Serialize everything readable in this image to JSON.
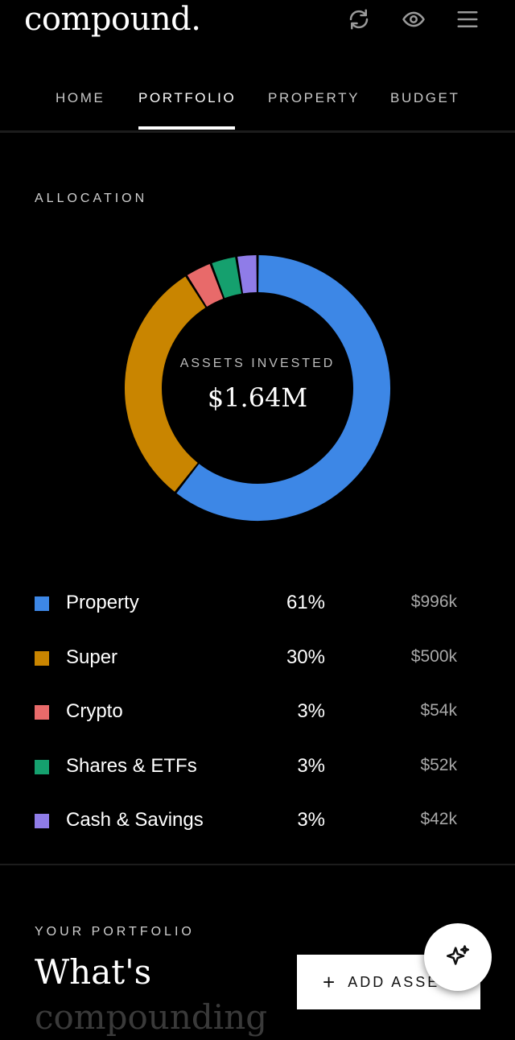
{
  "app": {
    "logo": "compound."
  },
  "header_icons": [
    "refresh-icon",
    "eye-icon",
    "menu-icon"
  ],
  "tabs": [
    {
      "label": "HOME",
      "active": false
    },
    {
      "label": "PORTFOLIO",
      "active": true
    },
    {
      "label": "PROPERTY",
      "active": false
    },
    {
      "label": "BUDGET",
      "active": false
    }
  ],
  "allocation": {
    "section_label": "ALLOCATION",
    "center_label": "ASSETS INVESTED",
    "center_value": "$1.64M",
    "items": [
      {
        "name": "Property",
        "percent": "61%",
        "amount": "$996k",
        "color": "#3d87e6"
      },
      {
        "name": "Super",
        "percent": "30%",
        "amount": "$500k",
        "color": "#c98500"
      },
      {
        "name": "Crypto",
        "percent": "3%",
        "amount": "$54k",
        "color": "#e86a6a"
      },
      {
        "name": "Shares & ETFs",
        "percent": "3%",
        "amount": "$52k",
        "color": "#15a06e"
      },
      {
        "name": "Cash & Savings",
        "percent": "3%",
        "amount": "$42k",
        "color": "#8f7ce8"
      }
    ]
  },
  "chart_data": {
    "type": "pie",
    "categories": [
      "Property",
      "Super",
      "Crypto",
      "Shares & ETFs",
      "Cash & Savings"
    ],
    "values": [
      996,
      500,
      54,
      52,
      42
    ],
    "percentages": [
      61,
      30,
      3,
      3,
      3
    ],
    "colors": [
      "#3d87e6",
      "#c98500",
      "#e86a6a",
      "#15a06e",
      "#8f7ce8"
    ],
    "style": "donut"
  },
  "portfolio": {
    "section_label": "YOUR PORTFOLIO",
    "title_line1": "What's",
    "title_line2": "compounding",
    "add_button": "ADD ASSET"
  },
  "fab_icon": "sparkle-icon"
}
